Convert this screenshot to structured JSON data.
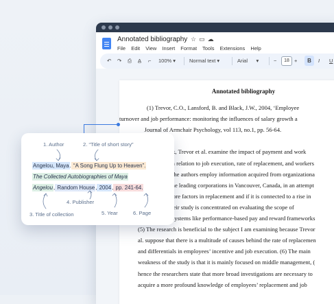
{
  "document": {
    "title": "Annotated bibliography",
    "menus": [
      "File",
      "Edit",
      "View",
      "Insert",
      "Format",
      "Tools",
      "Extensions",
      "Help"
    ],
    "toolbar": {
      "zoom": "100%",
      "style": "Normal text",
      "font": "Arial",
      "font_size": "18",
      "bold": "B",
      "italic": "I",
      "underline": "U"
    }
  },
  "body": {
    "heading": "Annotated bibliography",
    "lines": [
      "      (1) Trevor, C.O., Lansford, B. and Black, J.W., 2004, ‘Employee",
      "turnover and job performance: monitoring the influences of salary growth a",
      "                 Journal of Armchair Psychology, vol 113, no.1, pp. 56-64.",
      "",
      "                      rk, Trevor et al. examine the impact of payment and work",
      "                      in relation to job execution, rate of replacement, and workers",
      "                      The authors employ information acquired from organizationa",
      "                      the leading corporations in Vancouver, Canada, in an attempt",
      "                      core factors in replacement and if it is connected to a rise in",
      "                      heir study is concentrated on evaluating the scope of",
      "compensation systems like performance-based pay and reward frameworks",
      "(5) The research is beneficial to the subject I am examining because Trevor",
      "al. suppose that there is a multitude of causes behind the rate of replacemen",
      "and differentials in employees’ incentive and job execution. (6) The main",
      "weakness of the study is that it is mainly focused on middle management, (",
      "hence the researchers state that more broad investigations are necessary to",
      "acquire a more profound knowledge of employees’ replacement and job"
    ]
  },
  "card": {
    "labels": {
      "author": "1. Author",
      "short_story": "2. “Title of short story”",
      "publisher": "4. Publisher",
      "collection": "3. Title of collection",
      "year": "5. Year",
      "page": "6. Page"
    },
    "citation": {
      "author": "Angelou, Maya",
      "dot": ".",
      "story": " “A Song Flung Up to Heaven”.",
      "collection": "The Collected Autobiographies of Maya",
      "collection_it": "Angelou",
      "comma": ",",
      "publisher": " Random House",
      "comma2": ",",
      "year": " 2004",
      "comma3": ",",
      "pages": " pp. 241-64."
    }
  }
}
